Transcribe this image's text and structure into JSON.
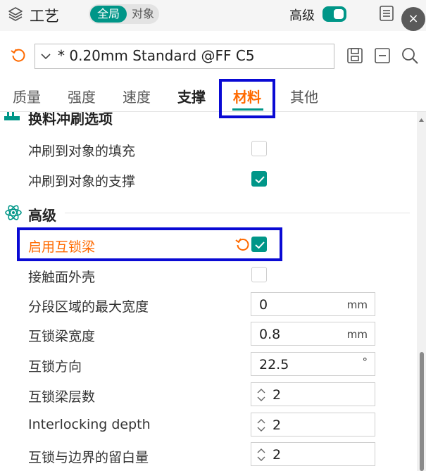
{
  "header": {
    "title": "工艺",
    "scope_global": "全局",
    "scope_object": "对象",
    "advanced_label": "高级",
    "advanced_on": true,
    "close_symbol": "×"
  },
  "preset": {
    "name": "* 0.20mm Standard @FF C5"
  },
  "tabs": [
    {
      "label": "质量"
    },
    {
      "label": "强度"
    },
    {
      "label": "速度"
    },
    {
      "label": "支撑"
    },
    {
      "label": "材料"
    },
    {
      "label": "其他"
    }
  ],
  "active_tab": "材料",
  "sections": {
    "flush": {
      "title": "换料冲刷选项",
      "rows": [
        {
          "label": "冲刷到对象的填充",
          "checked": false
        },
        {
          "label": "冲刷到对象的支撑",
          "checked": true
        }
      ]
    },
    "advanced": {
      "title": "高级",
      "rows": [
        {
          "label": "启用互锁梁",
          "checked": true,
          "modified": true
        },
        {
          "label": "接触面外壳",
          "checked": false
        },
        {
          "label": "分段区域的最大宽度",
          "value": "0",
          "unit": "mm"
        },
        {
          "label": "互锁梁宽度",
          "value": "0.8",
          "unit": "mm"
        },
        {
          "label": "互锁方向",
          "value": "22.5",
          "unit": "°"
        },
        {
          "label": "互锁梁层数",
          "value": "2"
        },
        {
          "label": "Interlocking depth",
          "value": "2"
        },
        {
          "label": "互锁与边界的留白量",
          "value": "2"
        }
      ]
    }
  },
  "colors": {
    "accent": "#009688",
    "modified": "#ff6a00",
    "highlight": "#0a0ad4"
  }
}
